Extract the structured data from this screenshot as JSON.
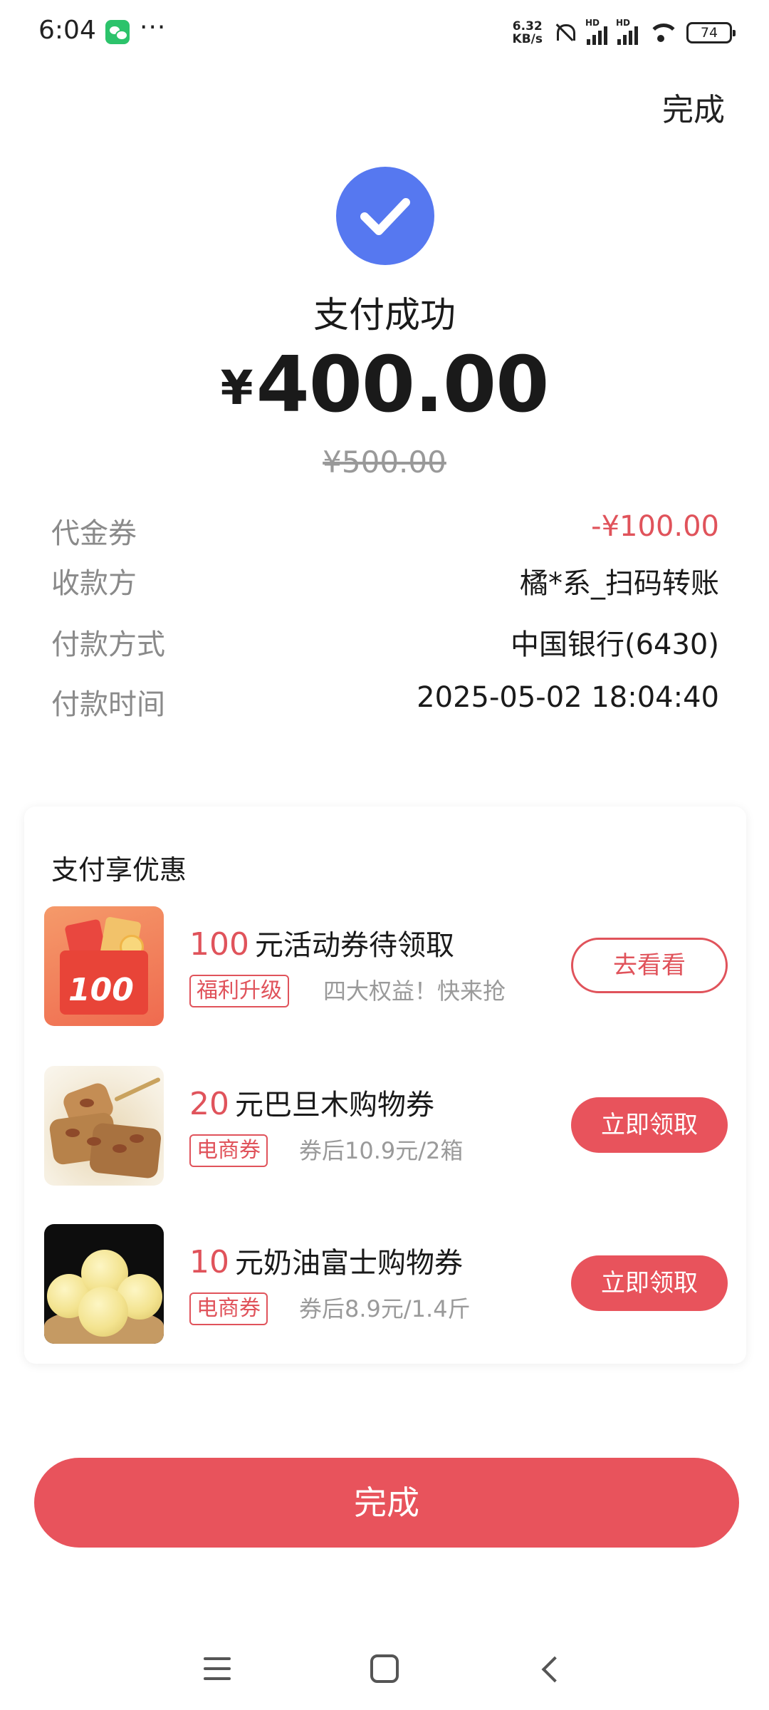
{
  "status_bar": {
    "time": "6:04",
    "more": "···",
    "net_speed_value": "6.32",
    "net_speed_unit": "KB/s",
    "hd_label": "HD",
    "battery": "74"
  },
  "header": {
    "done_label": "完成"
  },
  "result": {
    "title": "支付成功",
    "currency": "¥",
    "amount": "400.00",
    "original_amount": "¥500.00",
    "accent_color": "#5678f0"
  },
  "details": [
    {
      "label": "代金券",
      "value": "-¥100.00"
    },
    {
      "label": "收款方",
      "value": "橘*系_扫码转账"
    },
    {
      "label": "付款方式",
      "value": "中国银行(6430)"
    },
    {
      "label": "付款时间",
      "value": "2025-05-02 18:04:40"
    }
  ],
  "promo": {
    "title": "支付享优惠",
    "items": [
      {
        "highlight": "100",
        "title": "元活动券待领取",
        "tag": "福利升级",
        "subtitle": "四大权益！快来抢",
        "button": "去看看",
        "thumb_text": "100"
      },
      {
        "highlight": "20",
        "title": "元巴旦木购物券",
        "tag": "电商券",
        "subtitle": "券后10.9元/2箱",
        "button": "立即领取"
      },
      {
        "highlight": "10",
        "title": "元奶油富士购物券",
        "tag": "电商券",
        "subtitle": "券后8.9元/1.4斤",
        "button": "立即领取"
      }
    ]
  },
  "footer": {
    "done_label": "完成",
    "brand_red": "#e8535c"
  }
}
